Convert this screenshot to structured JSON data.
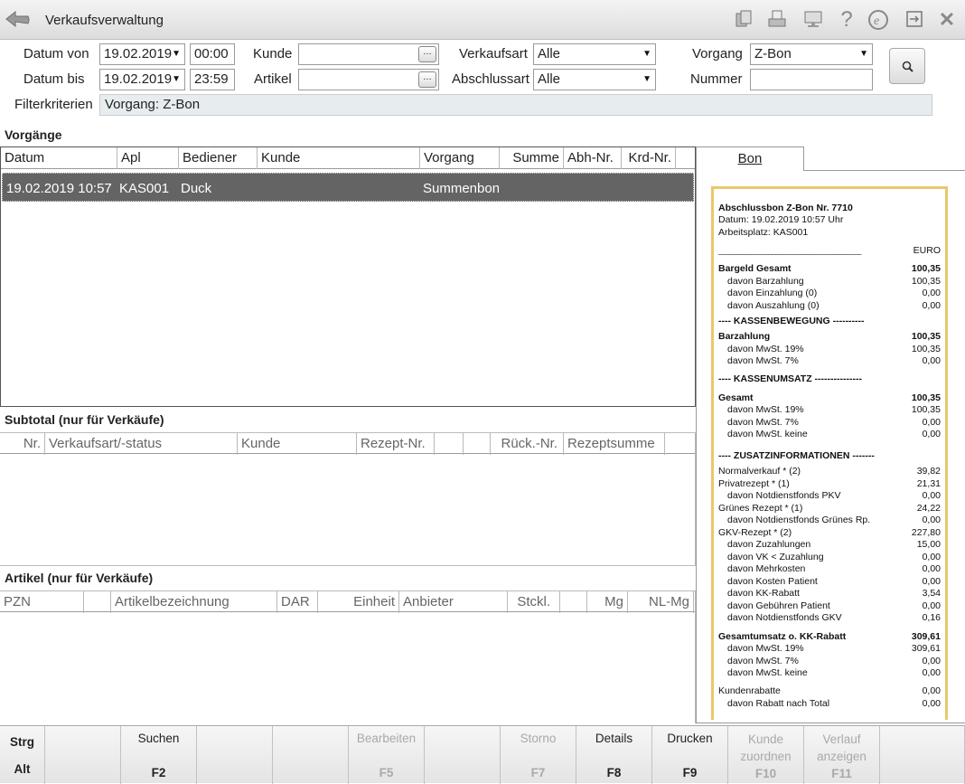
{
  "title": "Verkaufsverwaltung",
  "filters": {
    "datum_von_label": "Datum von",
    "datum_von": "19.02.2019",
    "zeit_von": "00:00",
    "datum_bis_label": "Datum bis",
    "datum_bis": "19.02.2019",
    "zeit_bis": "23:59",
    "kunde_label": "Kunde",
    "kunde": "",
    "artikel_label": "Artikel",
    "artikel": "",
    "verkaufsart_label": "Verkaufsart",
    "verkaufsart": "Alle",
    "abschlussart_label": "Abschlussart",
    "abschlussart": "Alle",
    "vorgang_label": "Vorgang",
    "vorgang": "Z-Bon",
    "nummer_label": "Nummer",
    "nummer": "",
    "kriterien_label": "Filterkriterien",
    "kriterien": "Vorgang: Z-Bon"
  },
  "vorgaenge": {
    "title": "Vorgänge",
    "headers": [
      "Datum",
      "Apl",
      "Bediener",
      "Kunde",
      "Vorgang",
      "Summe",
      "Abh-Nr.",
      "Krd-Nr."
    ],
    "row": {
      "datum": "19.02.2019 10:57",
      "apl": "KAS001",
      "bediener": "Duck",
      "kunde": "",
      "vorgang": "Summenbon",
      "summe": "",
      "abh": "",
      "krd": ""
    }
  },
  "subtotal": {
    "title": "Subtotal (nur für Verkäufe)",
    "headers": [
      "Nr.",
      "Verkaufsart/-status",
      "Kunde",
      "Rezept-Nr.",
      "",
      "",
      "Rück.-Nr.",
      "Rezeptsumme"
    ]
  },
  "artikel": {
    "title": "Artikel (nur für Verkäufe)",
    "headers": [
      "PZN",
      "",
      "Artikelbezeichnung",
      "DAR",
      "Einheit",
      "Anbieter",
      "Stckl.",
      "",
      "Mg",
      "NL-Mg"
    ]
  },
  "bon": {
    "tab": "Bon",
    "lines": [
      {
        "t": "Abschlussbon Z-Bon Nr. 7710",
        "v": "",
        "b": true,
        "i": false
      },
      {
        "t": "Datum: 19.02.2019  10:57 Uhr",
        "v": "",
        "b": false,
        "i": false
      },
      {
        "t": "Arbeitsplatz: KAS001",
        "v": "",
        "b": false,
        "i": false
      },
      {
        "t": "________________________________________",
        "v": "EURO",
        "b": false,
        "i": false
      },
      {
        "t": "Bargeld Gesamt",
        "v": "100,35",
        "b": true,
        "i": false
      },
      {
        "t": "davon Barzahlung",
        "v": "100,35",
        "b": false,
        "i": true
      },
      {
        "t": "davon Einzahlung (0)",
        "v": "0,00",
        "b": false,
        "i": true
      },
      {
        "t": "davon Auszahlung (0)",
        "v": "0,00",
        "b": false,
        "i": true
      },
      {
        "t": "----   KASSENBEWEGUNG   ----------",
        "v": "",
        "b": true,
        "i": false
      },
      {
        "t": "Barzahlung",
        "v": "100,35",
        "b": true,
        "i": false
      },
      {
        "t": "davon MwSt. 19%",
        "v": "100,35",
        "b": false,
        "i": true
      },
      {
        "t": "davon MwSt. 7%",
        "v": "0,00",
        "b": false,
        "i": true
      },
      {
        "t": "----   KASSENUMSATZ   ---------------",
        "v": "",
        "b": true,
        "i": false
      },
      {
        "t": "Gesamt",
        "v": "100,35",
        "b": true,
        "i": false
      },
      {
        "t": "davon MwSt. 19%",
        "v": "100,35",
        "b": false,
        "i": true
      },
      {
        "t": "davon MwSt. 7%",
        "v": "0,00",
        "b": false,
        "i": true
      },
      {
        "t": "davon MwSt. keine",
        "v": "0,00",
        "b": false,
        "i": true
      },
      {
        "t": "----   ZUSATZINFORMATIONEN   -------",
        "v": "",
        "b": true,
        "i": false
      },
      {
        "t": "Normalverkauf * (2)",
        "v": "39,82",
        "b": false,
        "i": false
      },
      {
        "t": "Privatrezept * (1)",
        "v": "21,31",
        "b": false,
        "i": false
      },
      {
        "t": "davon Notdienstfonds PKV",
        "v": "0,00",
        "b": false,
        "i": true
      },
      {
        "t": "Grünes Rezept * (1)",
        "v": "24,22",
        "b": false,
        "i": false
      },
      {
        "t": "davon Notdienstfonds Grünes Rp.",
        "v": "0,00",
        "b": false,
        "i": true
      },
      {
        "t": "GKV-Rezept * (2)",
        "v": "227,80",
        "b": false,
        "i": false
      },
      {
        "t": "davon Zuzahlungen",
        "v": "15,00",
        "b": false,
        "i": true
      },
      {
        "t": "davon VK < Zuzahlung",
        "v": "0,00",
        "b": false,
        "i": true
      },
      {
        "t": "davon Mehrkosten",
        "v": "0,00",
        "b": false,
        "i": true
      },
      {
        "t": "davon Kosten Patient",
        "v": "0,00",
        "b": false,
        "i": true
      },
      {
        "t": "davon KK-Rabatt",
        "v": "3,54",
        "b": false,
        "i": true
      },
      {
        "t": "davon Gebühren Patient",
        "v": "0,00",
        "b": false,
        "i": true
      },
      {
        "t": "davon Notdienstfonds GKV",
        "v": "0,16",
        "b": false,
        "i": true
      },
      {
        "t": "Gesamtumsatz o. KK-Rabatt",
        "v": "309,61",
        "b": true,
        "i": false
      },
      {
        "t": "davon MwSt. 19%",
        "v": "309,61",
        "b": false,
        "i": true
      },
      {
        "t": "davon MwSt. 7%",
        "v": "0,00",
        "b": false,
        "i": true
      },
      {
        "t": "davon MwSt. keine",
        "v": "0,00",
        "b": false,
        "i": true
      },
      {
        "t": "Kundenrabatte",
        "v": "0,00",
        "b": false,
        "i": false
      },
      {
        "t": "davon Rabatt nach Total",
        "v": "0,00",
        "b": false,
        "i": true
      }
    ]
  },
  "fkeys": [
    {
      "label": "Strg",
      "key": "Alt",
      "enabled": true
    },
    {
      "label": "",
      "key": "",
      "enabled": true
    },
    {
      "label": "Suchen",
      "key": "F2",
      "enabled": true
    },
    {
      "label": "",
      "key": "",
      "enabled": true
    },
    {
      "label": "",
      "key": "",
      "enabled": true
    },
    {
      "label": "Bearbeiten",
      "key": "F5",
      "enabled": false
    },
    {
      "label": "",
      "key": "",
      "enabled": true
    },
    {
      "label": "Storno",
      "key": "F7",
      "enabled": false
    },
    {
      "label": "Details",
      "key": "F8",
      "enabled": true
    },
    {
      "label": "Drucken",
      "key": "F9",
      "enabled": true
    },
    {
      "label": "Kunde zuordnen",
      "key": "F10",
      "enabled": false
    },
    {
      "label": "Verlauf anzeigen",
      "key": "F11",
      "enabled": false
    },
    {
      "label": "",
      "key": "",
      "enabled": true
    }
  ],
  "icons": [
    "back-arrow-icon",
    "copy-pages-icon",
    "printer-icon",
    "monitor-icon",
    "help-icon",
    "e-info-icon",
    "exit-window-icon",
    "close-icon",
    "search-icon"
  ],
  "colors": {
    "selected_row": "#646464",
    "receipt_border": "#e7c86a"
  }
}
